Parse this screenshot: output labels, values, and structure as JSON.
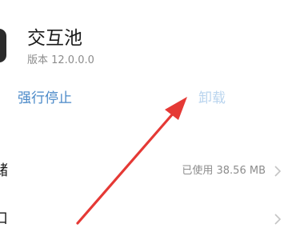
{
  "app": {
    "name": "交互池",
    "version": "版本 12.0.0.0"
  },
  "actions": {
    "force_stop": "强行停止",
    "uninstall": "卸载"
  },
  "rows": [
    {
      "label": "储",
      "value": "已使用 38.56 MB"
    },
    {
      "label": "口",
      "value": ""
    }
  ],
  "colors": {
    "accent": "#4a89c8",
    "disabled_accent": "#b9d4ee",
    "annotation_arrow": "#e53935"
  }
}
